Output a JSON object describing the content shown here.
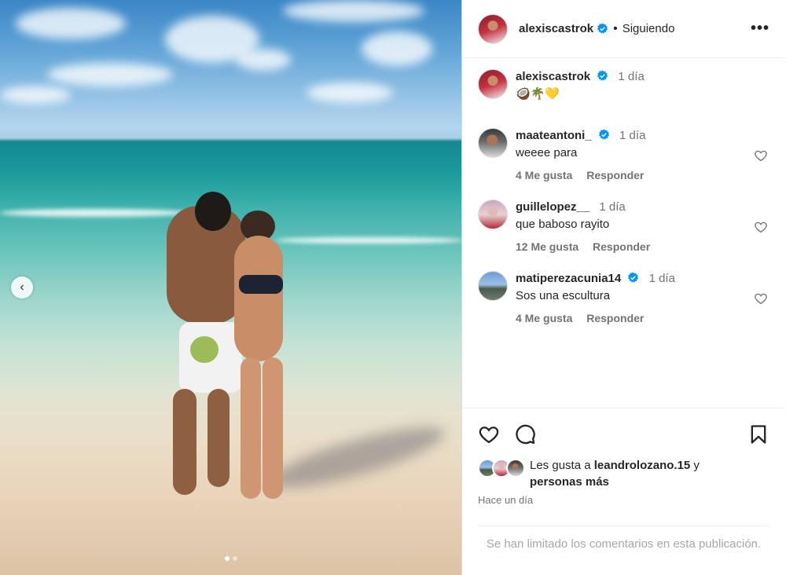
{
  "post": {
    "author": "alexiscastrok",
    "follow_status": "Siguiendo",
    "separator": "•",
    "more_icon": "more-icon",
    "caption": {
      "user": "alexiscastrok",
      "time": "1 día",
      "text": "🥥🌴💛"
    }
  },
  "comments": [
    {
      "user": "maateantoni_",
      "verified": true,
      "time": "1 día",
      "text": "weeee para",
      "likes": "4 Me gusta",
      "reply": "Responder"
    },
    {
      "user": "guillelopez__",
      "verified": false,
      "time": "1 día",
      "text": "que baboso rayito",
      "likes": "12 Me gusta",
      "reply": "Responder"
    },
    {
      "user": "matiperezacunia14",
      "verified": true,
      "time": "1 día",
      "text": "Sos una escultura",
      "likes": "4 Me gusta",
      "reply": "Responder"
    }
  ],
  "likes": {
    "prefix": "Les gusta a ",
    "user": "leandrolozano.15",
    "suffix": " y",
    "more": "personas más"
  },
  "date": "Hace un día",
  "limited_notice": "Se han limitado los comentarios en esta publicación.",
  "carousel": {
    "current": 1,
    "total": 2
  },
  "colors": {
    "verified": "#0095f6",
    "meta_gray": "#737373",
    "muted": "#a8a8a8"
  }
}
